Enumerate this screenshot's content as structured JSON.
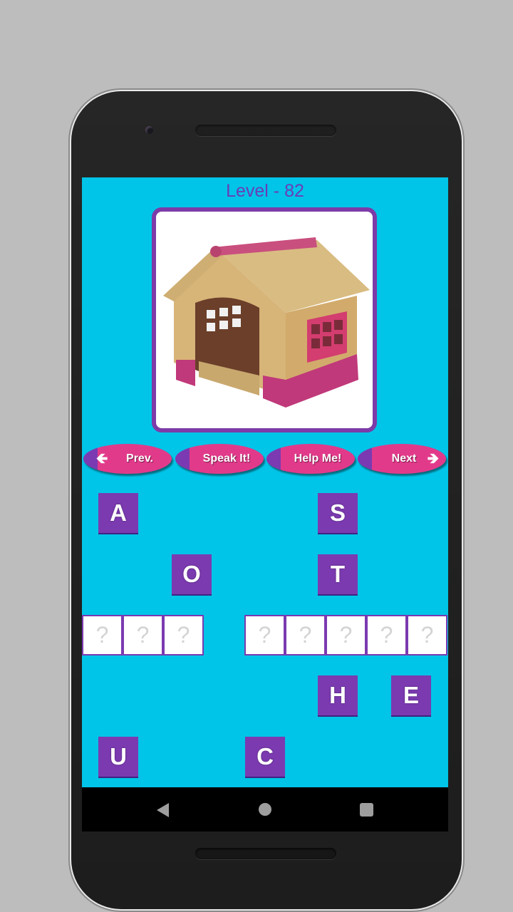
{
  "app": {
    "level_title": "Level - 82",
    "image": {
      "subject": "wooden dog house with pink trim",
      "icon": "doghouse-picture"
    }
  },
  "colors": {
    "background": "#00c4e8",
    "accent_purple": "#7b3ab0",
    "button_pink": "#e23a8b",
    "title_text": "#6a3db8"
  },
  "buttons": [
    {
      "id": "prev",
      "label": "Prev.",
      "icon": "arrow-left-icon",
      "icon_glyph": "🡸"
    },
    {
      "id": "speak",
      "label": "Speak It!"
    },
    {
      "id": "help",
      "label": "Help Me!"
    },
    {
      "id": "next",
      "label": "Next",
      "icon": "arrow-right-icon",
      "icon_glyph": "🡺"
    }
  ],
  "answer": {
    "words": [
      {
        "slots": [
          "?",
          "?",
          "?"
        ]
      },
      {
        "slots": [
          "?",
          "?",
          "?",
          "?",
          "?"
        ]
      }
    ]
  },
  "letters": [
    "A",
    "S",
    "O",
    "T",
    "H",
    "E",
    "U",
    "C"
  ],
  "navbar": {
    "back": "back-icon",
    "home": "home-icon",
    "recents": "recents-icon"
  }
}
